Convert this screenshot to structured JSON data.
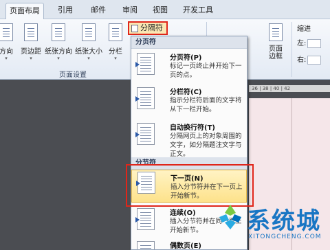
{
  "tabs": [
    {
      "label": "页面布局",
      "active": true
    },
    {
      "label": "引用",
      "active": false
    },
    {
      "label": "邮件",
      "active": false
    },
    {
      "label": "审阅",
      "active": false
    },
    {
      "label": "视图",
      "active": false
    },
    {
      "label": "开发工具",
      "active": false
    }
  ],
  "ribbon": {
    "buttons": [
      {
        "label": "方向",
        "has_dropdown": true
      },
      {
        "label": "页边距",
        "has_dropdown": true
      },
      {
        "label": "纸张方向",
        "has_dropdown": true
      },
      {
        "label": "纸张大小",
        "has_dropdown": true
      },
      {
        "label": "分栏",
        "has_dropdown": true
      }
    ],
    "group_label": "页面设置",
    "breaks_button": "分隔符",
    "page_border": "页面\n边框",
    "indent_label": "缩进",
    "indent_left": "左:",
    "indent_right": "右:",
    "dropdown_arrow": "▾"
  },
  "ruler_text": "36 | 38 | 40 | 42",
  "menu": {
    "section_page": "分页符",
    "section_section": "分节符",
    "items": [
      {
        "title": "分页符(P)",
        "desc": "标记一页终止并开始下一页的点。"
      },
      {
        "title": "分栏符(C)",
        "desc": "指示分栏符后面的文字将从下一栏开始。"
      },
      {
        "title": "自动换行符(T)",
        "desc": "分隔网页上的对象周围的文字，如分隔题注文字与正文。"
      },
      {
        "title": "下一页(N)",
        "desc": "插入分节符并在下一页上开始新节。",
        "highlighted": true
      },
      {
        "title": "连续(O)",
        "desc": "插入分节符并在同一页上开始新节。"
      },
      {
        "title": "偶数页(E)",
        "desc": ""
      }
    ]
  },
  "watermark": {
    "brand": "系统城",
    "domain": "XITONGCHENG.COM",
    "color": "#1976c4"
  },
  "colors": {
    "highlight_border": "#e0261a",
    "selected_item": "#fde28b"
  }
}
